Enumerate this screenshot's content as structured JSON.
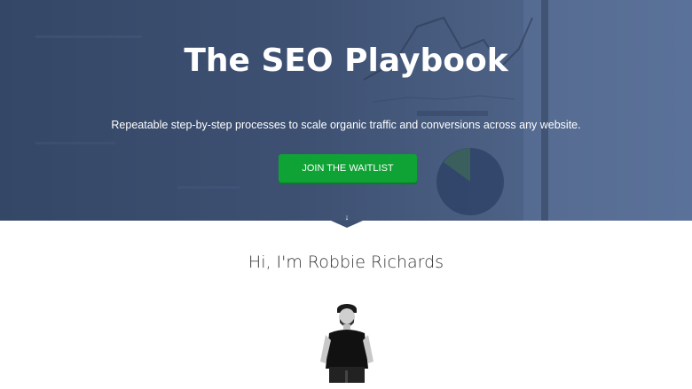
{
  "hero": {
    "title": "The SEO Playbook",
    "subtitle": "Repeatable step-by-step processes to scale organic traffic and conversions across any website.",
    "cta_label": "JOIN THE WAITLIST",
    "scroll_icon": "arrow-down-icon"
  },
  "intro": {
    "heading": "Hi, I'm Robbie Richards",
    "avatar": "profile-photo"
  },
  "colors": {
    "hero_bg": "#3e5173",
    "cta": "#0fa234",
    "text_dark": "#333333"
  }
}
